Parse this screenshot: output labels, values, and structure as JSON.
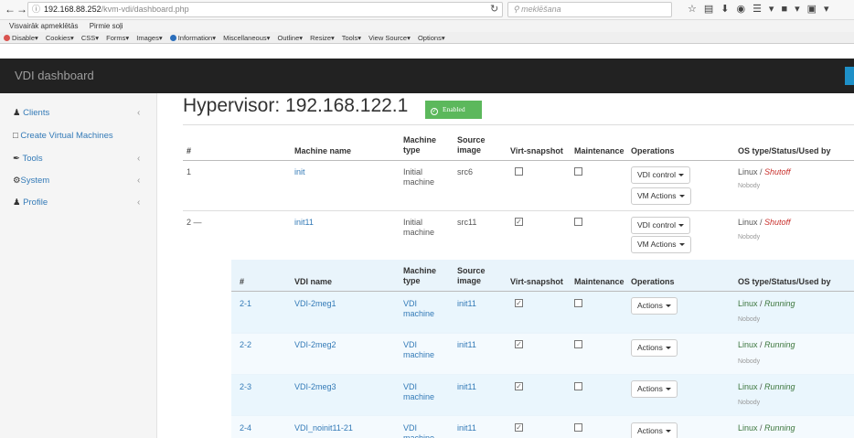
{
  "browser": {
    "url_host": "192.168.88.252",
    "url_path": "/kvm-vdi/dashboard.php",
    "search_placeholder": "meklēšana",
    "bookmarks": [
      "Visvairāk apmeklētās",
      "Pirmie soļi"
    ],
    "webdev": [
      "Disable",
      "Cookies",
      "CSS",
      "Forms",
      "Images",
      "Information",
      "Miscellaneous",
      "Outline",
      "Resize",
      "Tools",
      "View Source",
      "Options"
    ]
  },
  "app": {
    "brand": "VDI dashboard"
  },
  "sidebar": {
    "items": [
      {
        "label": "Clients",
        "icon": "users-icon"
      },
      {
        "label": "Create Virtual Machines",
        "icon": "monitor-icon"
      },
      {
        "label": "Tools",
        "icon": "wrench-icon"
      },
      {
        "label": "System",
        "icon": "gears-icon"
      },
      {
        "label": "Profile",
        "icon": "user-icon"
      }
    ]
  },
  "page": {
    "title": "Hypervisor: 192.168.122.1",
    "status_badge": "Enabled"
  },
  "machines_table": {
    "headers": [
      "#",
      "Machine name",
      "Machine type",
      "Source image",
      "Virt-snapshot",
      "Maintenance",
      "Operations",
      "OS type/Status/Used by"
    ],
    "rows": [
      {
        "id": "1",
        "name": "init",
        "type": "Initial machine",
        "source": "src6",
        "snapshot": false,
        "maintenance": false,
        "op1": "VDI control",
        "op2": "VM Actions",
        "os": "Linux",
        "status": "Shutoff",
        "used_by": "Nobody"
      },
      {
        "id": "2 —",
        "name": "init11",
        "type": "Initial machine",
        "source": "src11",
        "snapshot": true,
        "maintenance": false,
        "op1": "VDI control",
        "op2": "VM Actions",
        "os": "Linux",
        "status": "Shutoff",
        "used_by": "Nobody"
      }
    ]
  },
  "vdi_table": {
    "headers": [
      "#",
      "VDI name",
      "Machine type",
      "Source image",
      "Virt-snapshot",
      "Maintenance",
      "Operations",
      "OS type/Status/Used by"
    ],
    "rows": [
      {
        "id": "2-1",
        "name": "VDI-2meg1",
        "type": "VDI machine",
        "source": "init11",
        "snapshot": true,
        "maintenance": false,
        "op": "Actions",
        "os": "Linux",
        "status": "Running",
        "used_by": "Nobody"
      },
      {
        "id": "2-2",
        "name": "VDI-2meg2",
        "type": "VDI machine",
        "source": "init11",
        "snapshot": true,
        "maintenance": false,
        "op": "Actions",
        "os": "Linux",
        "status": "Running",
        "used_by": "Nobody"
      },
      {
        "id": "2-3",
        "name": "VDI-2meg3",
        "type": "VDI machine",
        "source": "init11",
        "snapshot": true,
        "maintenance": false,
        "op": "Actions",
        "os": "Linux",
        "status": "Running",
        "used_by": "Nobody"
      },
      {
        "id": "2-4",
        "name": "VDI_noinit11-21",
        "type": "VDI machine",
        "source": "init11",
        "snapshot": true,
        "maintenance": false,
        "op": "Actions",
        "os": "Linux",
        "status": "Running",
        "used_by": ""
      }
    ]
  }
}
